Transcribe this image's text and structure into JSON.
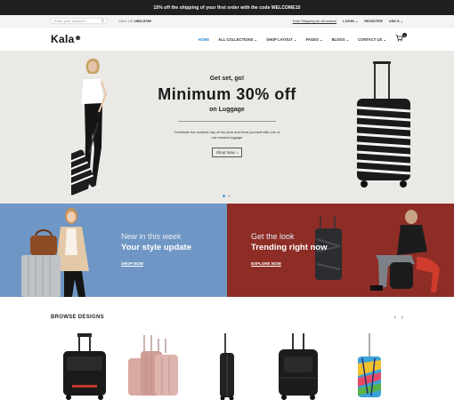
{
  "announcement": "15% off the shipping of your first order with the code WELCOME15",
  "utility": {
    "search_placeholder": "Enter your keyword...",
    "call_label": "CALL US",
    "call_number": "1500-5789",
    "shipping_link": "Free Shipping for all orders!",
    "login": "LOGIN",
    "register": "REGISTER",
    "currency": "USD $"
  },
  "nav": {
    "logo": "Kala",
    "items": [
      {
        "label": "HOME",
        "active": true
      },
      {
        "label": "ALL COLLECTIONS",
        "dropdown": true
      },
      {
        "label": "SHOP LAYOUT",
        "dropdown": true
      },
      {
        "label": "PAGES",
        "dropdown": true
      },
      {
        "label": "BLOGS",
        "dropdown": true
      },
      {
        "label": "CONTACT US",
        "dropdown": true
      }
    ],
    "cart_count": "0"
  },
  "hero": {
    "pre": "Get set, go!",
    "headline": "Minimum  30% off",
    "sub": "on Luggage",
    "desc": "Celebrate the scariest day of the year and treat yourself with one of our newest luggage",
    "button": "Shop Now",
    "slides": 2,
    "active_slide": 1
  },
  "promos": [
    {
      "line1": "New in this week",
      "line2": "Your style update",
      "cta": "SHOP NOW"
    },
    {
      "line1": "Get the look",
      "line2": "Trending right now",
      "cta": "EXPLORE NOW"
    }
  ],
  "browse": {
    "title": "BROWSE DESIGNS"
  },
  "colors": {
    "accent": "#2e8bd8",
    "promo_blue": "#6f96c4",
    "promo_red": "#8e2d26",
    "topbar": "#1f1f1f"
  }
}
